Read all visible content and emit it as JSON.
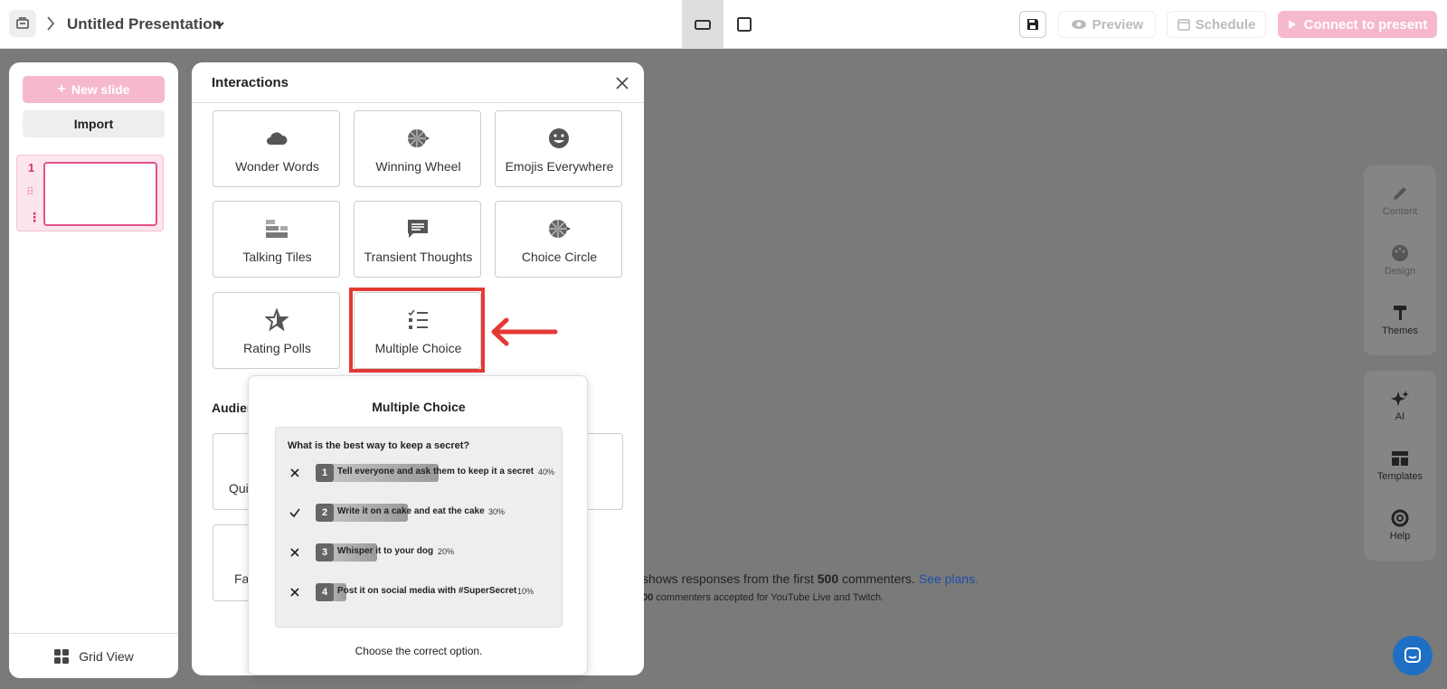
{
  "topbar": {
    "title": "Untitled Presentation",
    "preview_label": "Preview",
    "schedule_label": "Schedule",
    "connect_label": "Connect to present"
  },
  "sidebar": {
    "new_slide_label": "New slide",
    "import_label": "Import",
    "slide_number": "1",
    "grid_view_label": "Grid View"
  },
  "rail": {
    "top": [
      {
        "label": "Content",
        "icon": "pencil-icon"
      },
      {
        "label": "Design",
        "icon": "palette-icon"
      },
      {
        "label": "Themes",
        "icon": "paint-roller-icon"
      }
    ],
    "bottom": [
      {
        "label": "AI",
        "icon": "sparkles-icon"
      },
      {
        "label": "Templates",
        "icon": "templates-icon"
      },
      {
        "label": "Help",
        "icon": "lifebuoy-icon"
      }
    ]
  },
  "behind": {
    "line1_pre": "shows responses from the first ",
    "line1_bold": "500",
    "line1_post": " commenters. ",
    "line1_link": "See plans.",
    "line2_bold": "00",
    "line2_post": " commenters accepted for YouTube Live and Twitch."
  },
  "modal": {
    "title": "Interactions",
    "cards": [
      {
        "label": "Wonder Words",
        "icon": "cloud-icon"
      },
      {
        "label": "Winning Wheel",
        "icon": "wheel-icon"
      },
      {
        "label": "Emojis Everywhere",
        "icon": "smiley-icon"
      },
      {
        "label": "Talking Tiles",
        "icon": "tiles-icon"
      },
      {
        "label": "Transient Thoughts",
        "icon": "chat-bubble-icon"
      },
      {
        "label": "Choice Circle",
        "icon": "wheel-icon"
      },
      {
        "label": "Rating Polls",
        "icon": "star-icon"
      },
      {
        "label": "Multiple Choice",
        "icon": "checklist-icon"
      }
    ],
    "section_partial": "Audien",
    "frag1": "Qui",
    "frag2": "Fa"
  },
  "tooltip": {
    "title": "Multiple Choice",
    "question": "What is the best way to keep a secret?",
    "options": [
      {
        "num": "1",
        "text": "Tell everyone and ask them to keep it a secret",
        "pct": "40%",
        "correct": false,
        "share": 0.4
      },
      {
        "num": "2",
        "text": "Write it on a cake and eat the cake",
        "pct": "30%",
        "correct": true,
        "share": 0.3
      },
      {
        "num": "3",
        "text": "Whisper it to your dog",
        "pct": "20%",
        "correct": false,
        "share": 0.2
      },
      {
        "num": "4",
        "text": "Post it on social media with #SuperSecret",
        "pct": "10%",
        "correct": false,
        "share": 0.1
      }
    ],
    "caption": "Choose the correct option."
  },
  "colors": {
    "accent_pink": "#f6b8cd",
    "highlight_red": "#e53935",
    "link_blue": "#1e4fa8"
  }
}
